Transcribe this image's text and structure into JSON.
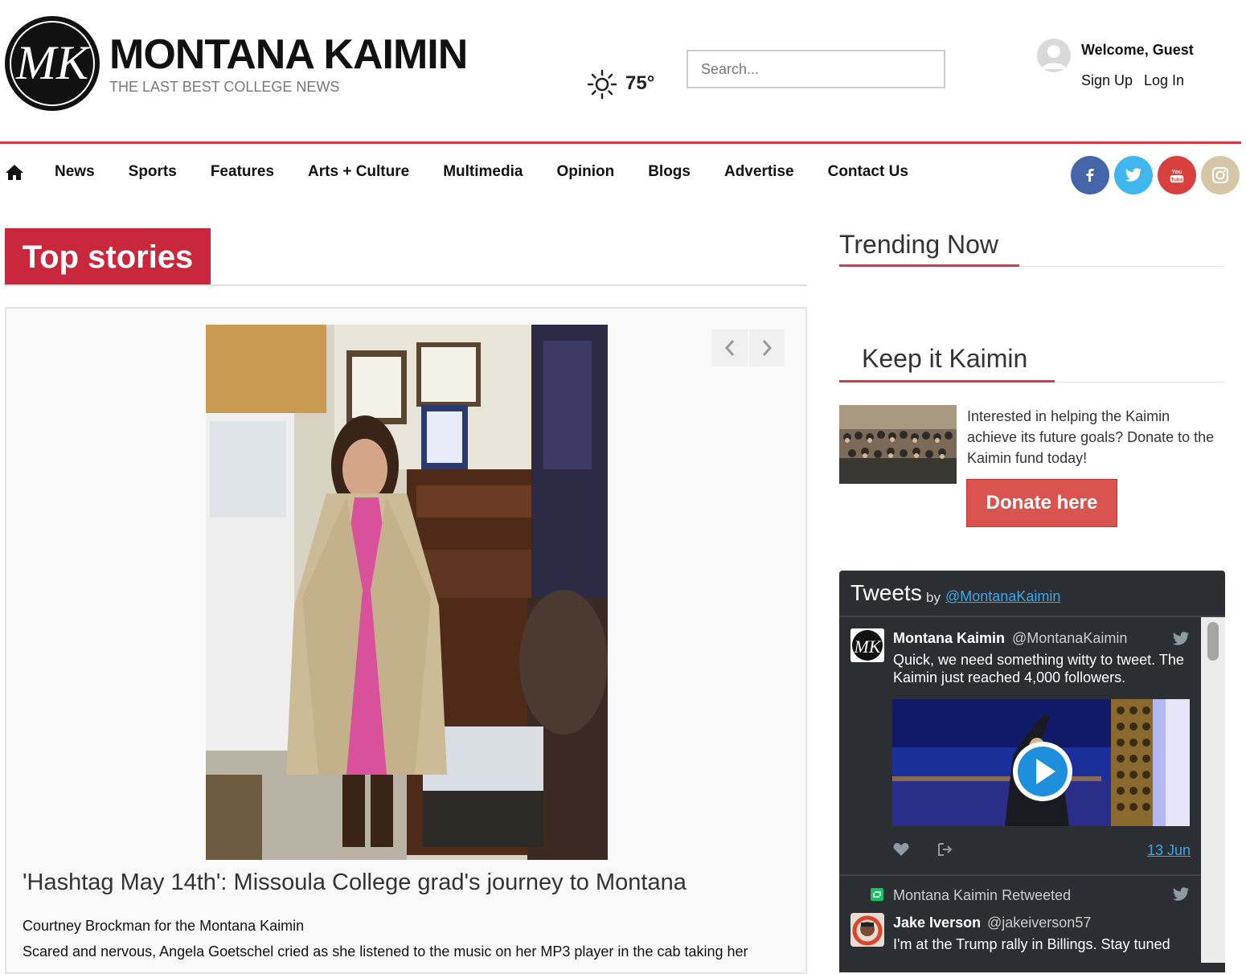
{
  "header": {
    "logo_text": "MK",
    "site_name": "MONTANA KAIMIN",
    "tagline": "THE LAST BEST COLLEGE NEWS",
    "weather_icon": "sun-icon",
    "temperature": "75°",
    "search_placeholder": "Search...",
    "welcome": "Welcome, Guest",
    "sign_up": "Sign Up",
    "log_in": "Log In"
  },
  "nav": {
    "home_icon": "home-icon",
    "items": [
      "News",
      "Sports",
      "Features",
      "Arts + Culture",
      "Multimedia",
      "Opinion",
      "Blogs",
      "Advertise",
      "Contact Us"
    ],
    "social": [
      "facebook-icon",
      "twitter-icon",
      "youtube-icon",
      "instagram-icon"
    ]
  },
  "top_stories": {
    "heading": "Top stories",
    "story": {
      "title": "'Hashtag May 14th': Missoula College grad's journey to Montana",
      "byline": "Courtney Brockman for the Montana Kaimin",
      "excerpt": "Scared and nervous, Angela Goetschel cried as she listened to the music on her MP3 player in the cab taking her"
    }
  },
  "sidebar": {
    "trending_heading": "Trending Now",
    "keep_heading": "Keep it Kaimin",
    "keep_text": "Interested in helping the Kaimin achieve its future goals? Donate to the Kaimin fund today!",
    "donate_label": "Donate here"
  },
  "tweets": {
    "heading": "Tweets",
    "by": "by",
    "handle": "@MontanaKaimin",
    "tweet1": {
      "name": "Montana Kaimin",
      "user": "@MontanaKaimin",
      "text": "Quick, we need something witty to tweet. The Kaimin just reached 4,000 followers.",
      "date": "13 Jun"
    },
    "retweet_label": "Montana Kaimin Retweeted",
    "tweet2": {
      "name": "Jake Iverson",
      "user": "@jakeiverson57",
      "text": "I'm at the Trump rally in Billings. Stay tuned"
    }
  },
  "colors": {
    "accent_red": "#c9283c",
    "nav_rule": "#d23a48",
    "donate": "#d9534f",
    "twitter_blue": "#3ea6e8",
    "tweet_panel": "#2b2f33"
  }
}
